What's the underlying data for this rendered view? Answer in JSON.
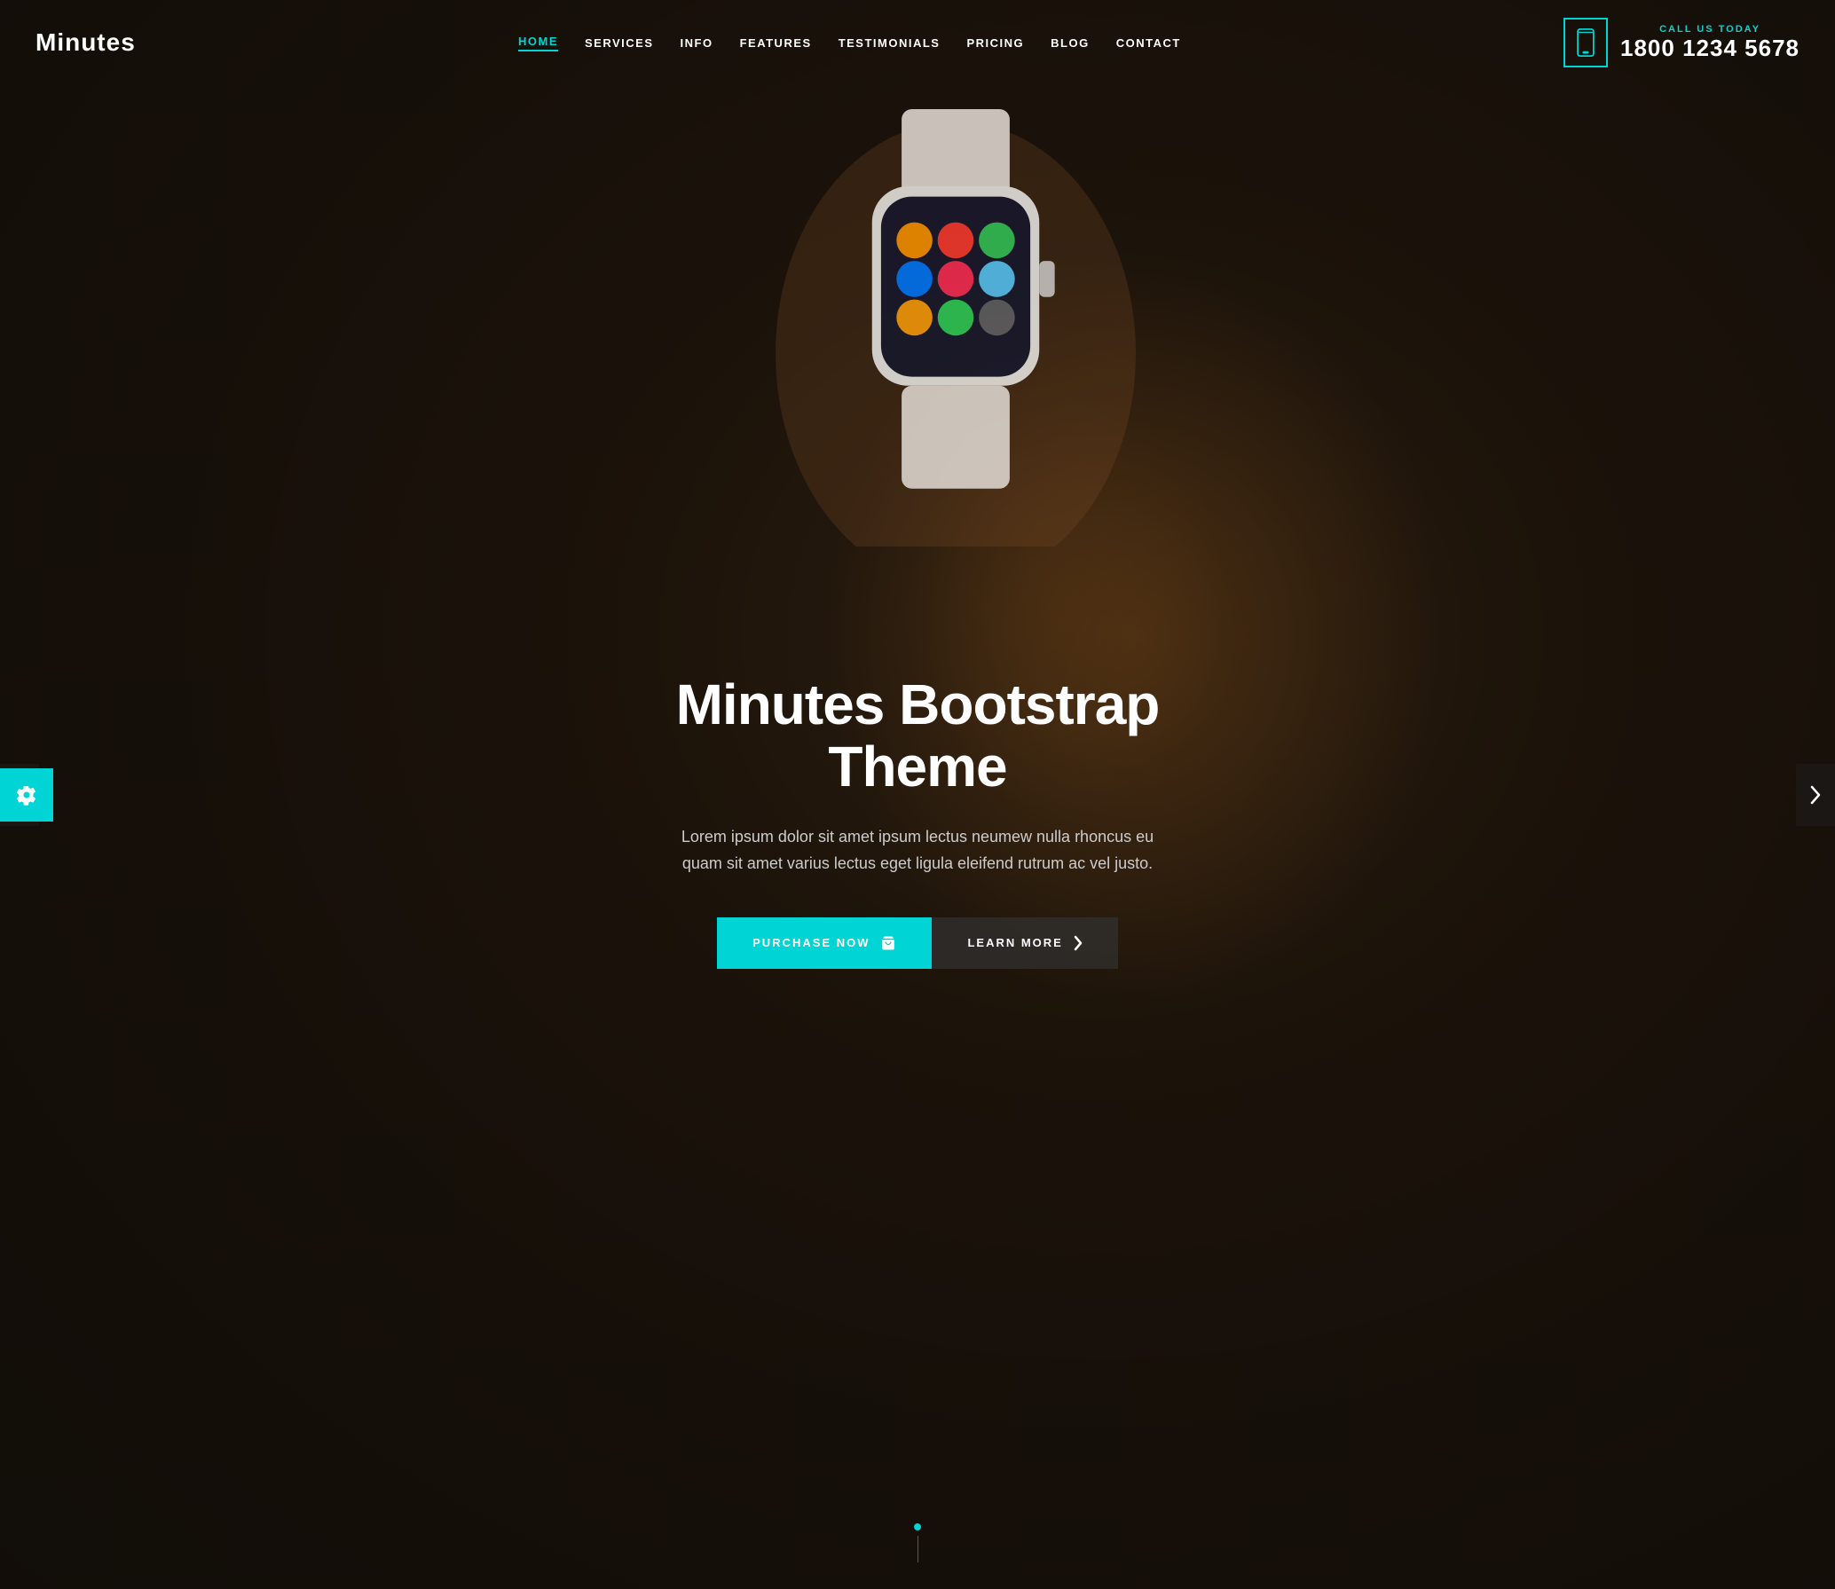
{
  "header": {
    "logo": "Minutes",
    "nav": {
      "items": [
        {
          "label": "HOME",
          "active": true,
          "key": "home"
        },
        {
          "label": "SERVICES",
          "active": false,
          "key": "services"
        },
        {
          "label": "INFO",
          "active": false,
          "key": "info"
        },
        {
          "label": "FEATURES",
          "active": false,
          "key": "features"
        },
        {
          "label": "TESTIMONIALS",
          "active": false,
          "key": "testimonials"
        },
        {
          "label": "PRICING",
          "active": false,
          "key": "pricing"
        },
        {
          "label": "BLOG",
          "active": false,
          "key": "blog"
        },
        {
          "label": "CONTACT",
          "active": false,
          "key": "contact"
        }
      ]
    },
    "contact": {
      "call_label": "CALL US TODAY",
      "phone": "1800 1234 5678"
    }
  },
  "hero": {
    "title": "Minutes Bootstrap Theme",
    "subtitle": "Lorem ipsum dolor sit amet ipsum lectus neumew nulla rhoncus eu quam sit amet varius lectus eget ligula eleifend rutrum ac vel justo.",
    "btn_primary_label": "PURCHASE NOW",
    "btn_secondary_label": "LEARN MORE",
    "cart_icon": "🛒",
    "chevron_icon": "›"
  },
  "settings": {
    "icon": "⚙"
  },
  "colors": {
    "accent": "#00d4d4",
    "dark": "#1a1008",
    "white": "#ffffff",
    "nav_text": "#ffffff",
    "subtitle_text": "#cccccc"
  }
}
